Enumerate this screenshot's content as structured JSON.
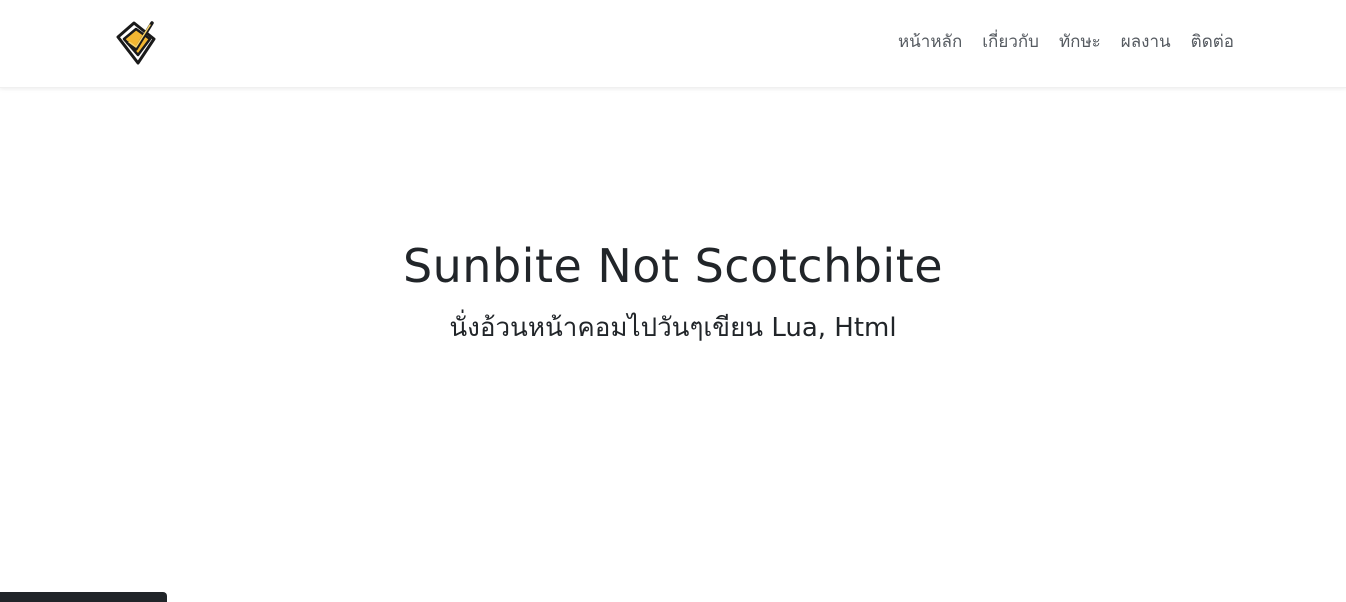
{
  "nav": {
    "items": [
      "หน้าหลัก",
      "เกี่ยวกับ",
      "ทักษะ",
      "ผลงาน",
      "ติดต่อ"
    ]
  },
  "hero": {
    "title": "Sunbite Not Scotchbite",
    "subtitle": "นั่งอ้วนหน้าคอมไปวันๆเขียน Lua, Html"
  },
  "colors": {
    "text": "#212529",
    "nav_text": "#555a60",
    "logo_gold": "#f2b632",
    "logo_outline": "#1a1a1a"
  },
  "icons": {
    "logo": "logo-icon"
  }
}
